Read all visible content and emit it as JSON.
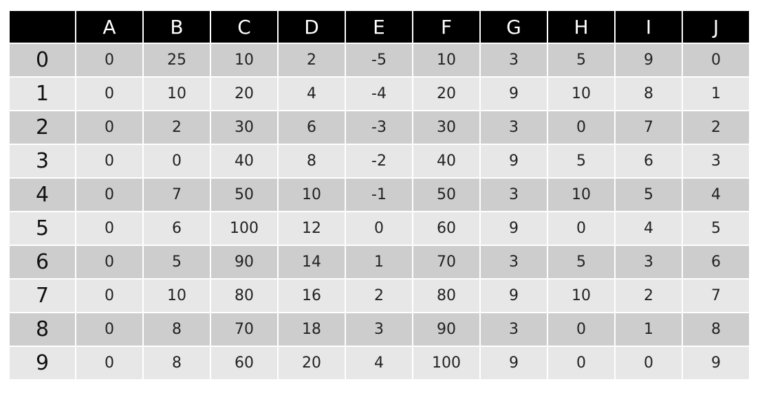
{
  "chart_data": {
    "type": "table",
    "columns": [
      "",
      "A",
      "B",
      "C",
      "D",
      "E",
      "F",
      "G",
      "H",
      "I",
      "J"
    ],
    "rows": [
      {
        "label": "0",
        "values": [
          "0",
          "25",
          "10",
          "2",
          "-5",
          "10",
          "3",
          "5",
          "9",
          "0"
        ]
      },
      {
        "label": "1",
        "values": [
          "0",
          "10",
          "20",
          "4",
          "-4",
          "20",
          "9",
          "10",
          "8",
          "1"
        ]
      },
      {
        "label": "2",
        "values": [
          "0",
          "2",
          "30",
          "6",
          "-3",
          "30",
          "3",
          "0",
          "7",
          "2"
        ]
      },
      {
        "label": "3",
        "values": [
          "0",
          "0",
          "40",
          "8",
          "-2",
          "40",
          "9",
          "5",
          "6",
          "3"
        ]
      },
      {
        "label": "4",
        "values": [
          "0",
          "7",
          "50",
          "10",
          "-1",
          "50",
          "3",
          "10",
          "5",
          "4"
        ]
      },
      {
        "label": "5",
        "values": [
          "0",
          "6",
          "100",
          "12",
          "0",
          "60",
          "9",
          "0",
          "4",
          "5"
        ]
      },
      {
        "label": "6",
        "values": [
          "0",
          "5",
          "90",
          "14",
          "1",
          "70",
          "3",
          "5",
          "3",
          "6"
        ]
      },
      {
        "label": "7",
        "values": [
          "0",
          "10",
          "80",
          "16",
          "2",
          "80",
          "9",
          "10",
          "2",
          "7"
        ]
      },
      {
        "label": "8",
        "values": [
          "0",
          "8",
          "70",
          "18",
          "3",
          "90",
          "3",
          "0",
          "1",
          "8"
        ]
      },
      {
        "label": "9",
        "values": [
          "0",
          "8",
          "60",
          "20",
          "4",
          "100",
          "9",
          "0",
          "0",
          "9"
        ]
      }
    ]
  },
  "colors": {
    "header_background": "#000000",
    "header_text": "#ffffff",
    "row_odd_background": "#cdcdcd",
    "row_even_background": "#e7e7e7"
  }
}
